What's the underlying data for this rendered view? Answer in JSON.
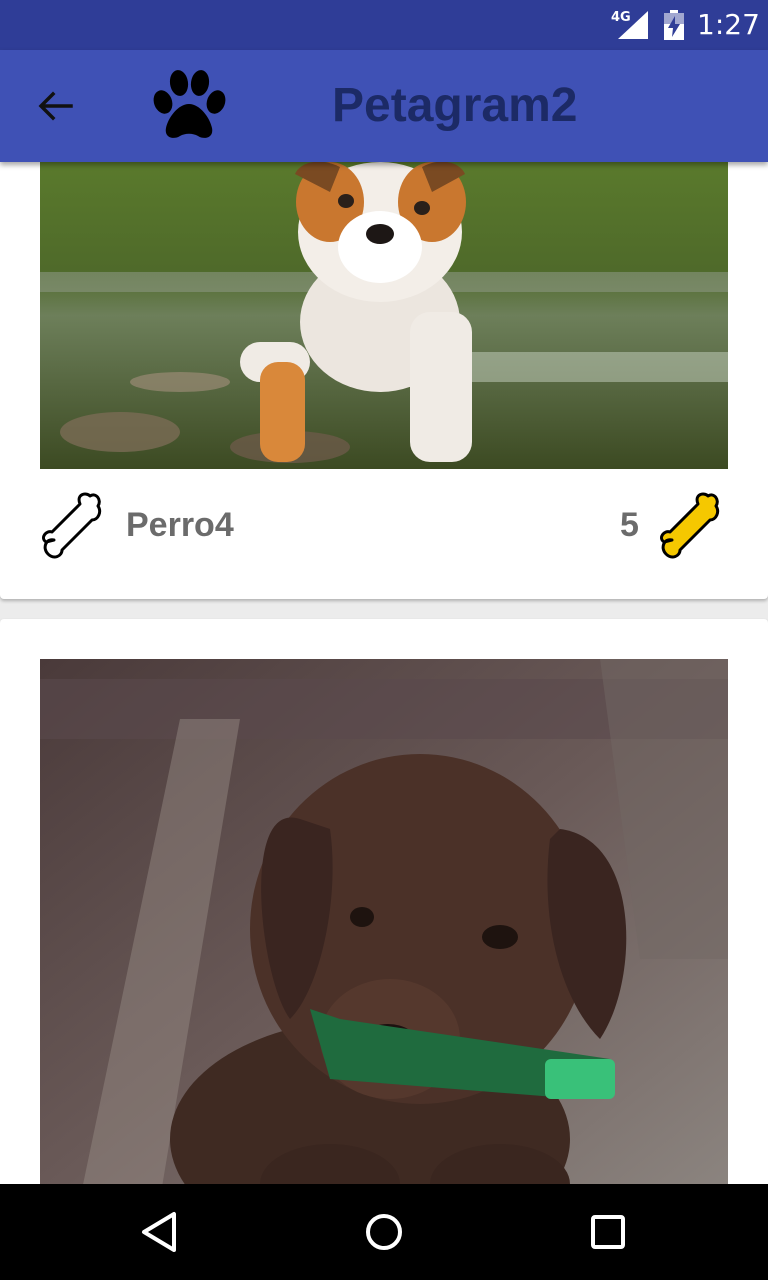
{
  "status_bar": {
    "network": "4G",
    "time": "1:27"
  },
  "toolbar": {
    "title": "Petagram2",
    "back_icon": "arrow-left-icon",
    "logo_icon": "paw-icon"
  },
  "cards": [
    {
      "name": "Perro4",
      "likes": "5",
      "photo": "bulldog-puppy-in-water",
      "rate_icon": "bone-outline-icon",
      "likes_icon": "bone-yellow-icon"
    },
    {
      "photo": "chocolate-labrador-puppy"
    }
  ],
  "navigation": {
    "back": "triangle-back-icon",
    "home": "circle-home-icon",
    "recents": "square-recents-icon"
  },
  "colors": {
    "status_bar": "#2f3d97",
    "toolbar": "#3f51b5",
    "title": "#1c2a66",
    "bone_yellow": "#f5c800",
    "text_gray": "#6b6b6b"
  }
}
